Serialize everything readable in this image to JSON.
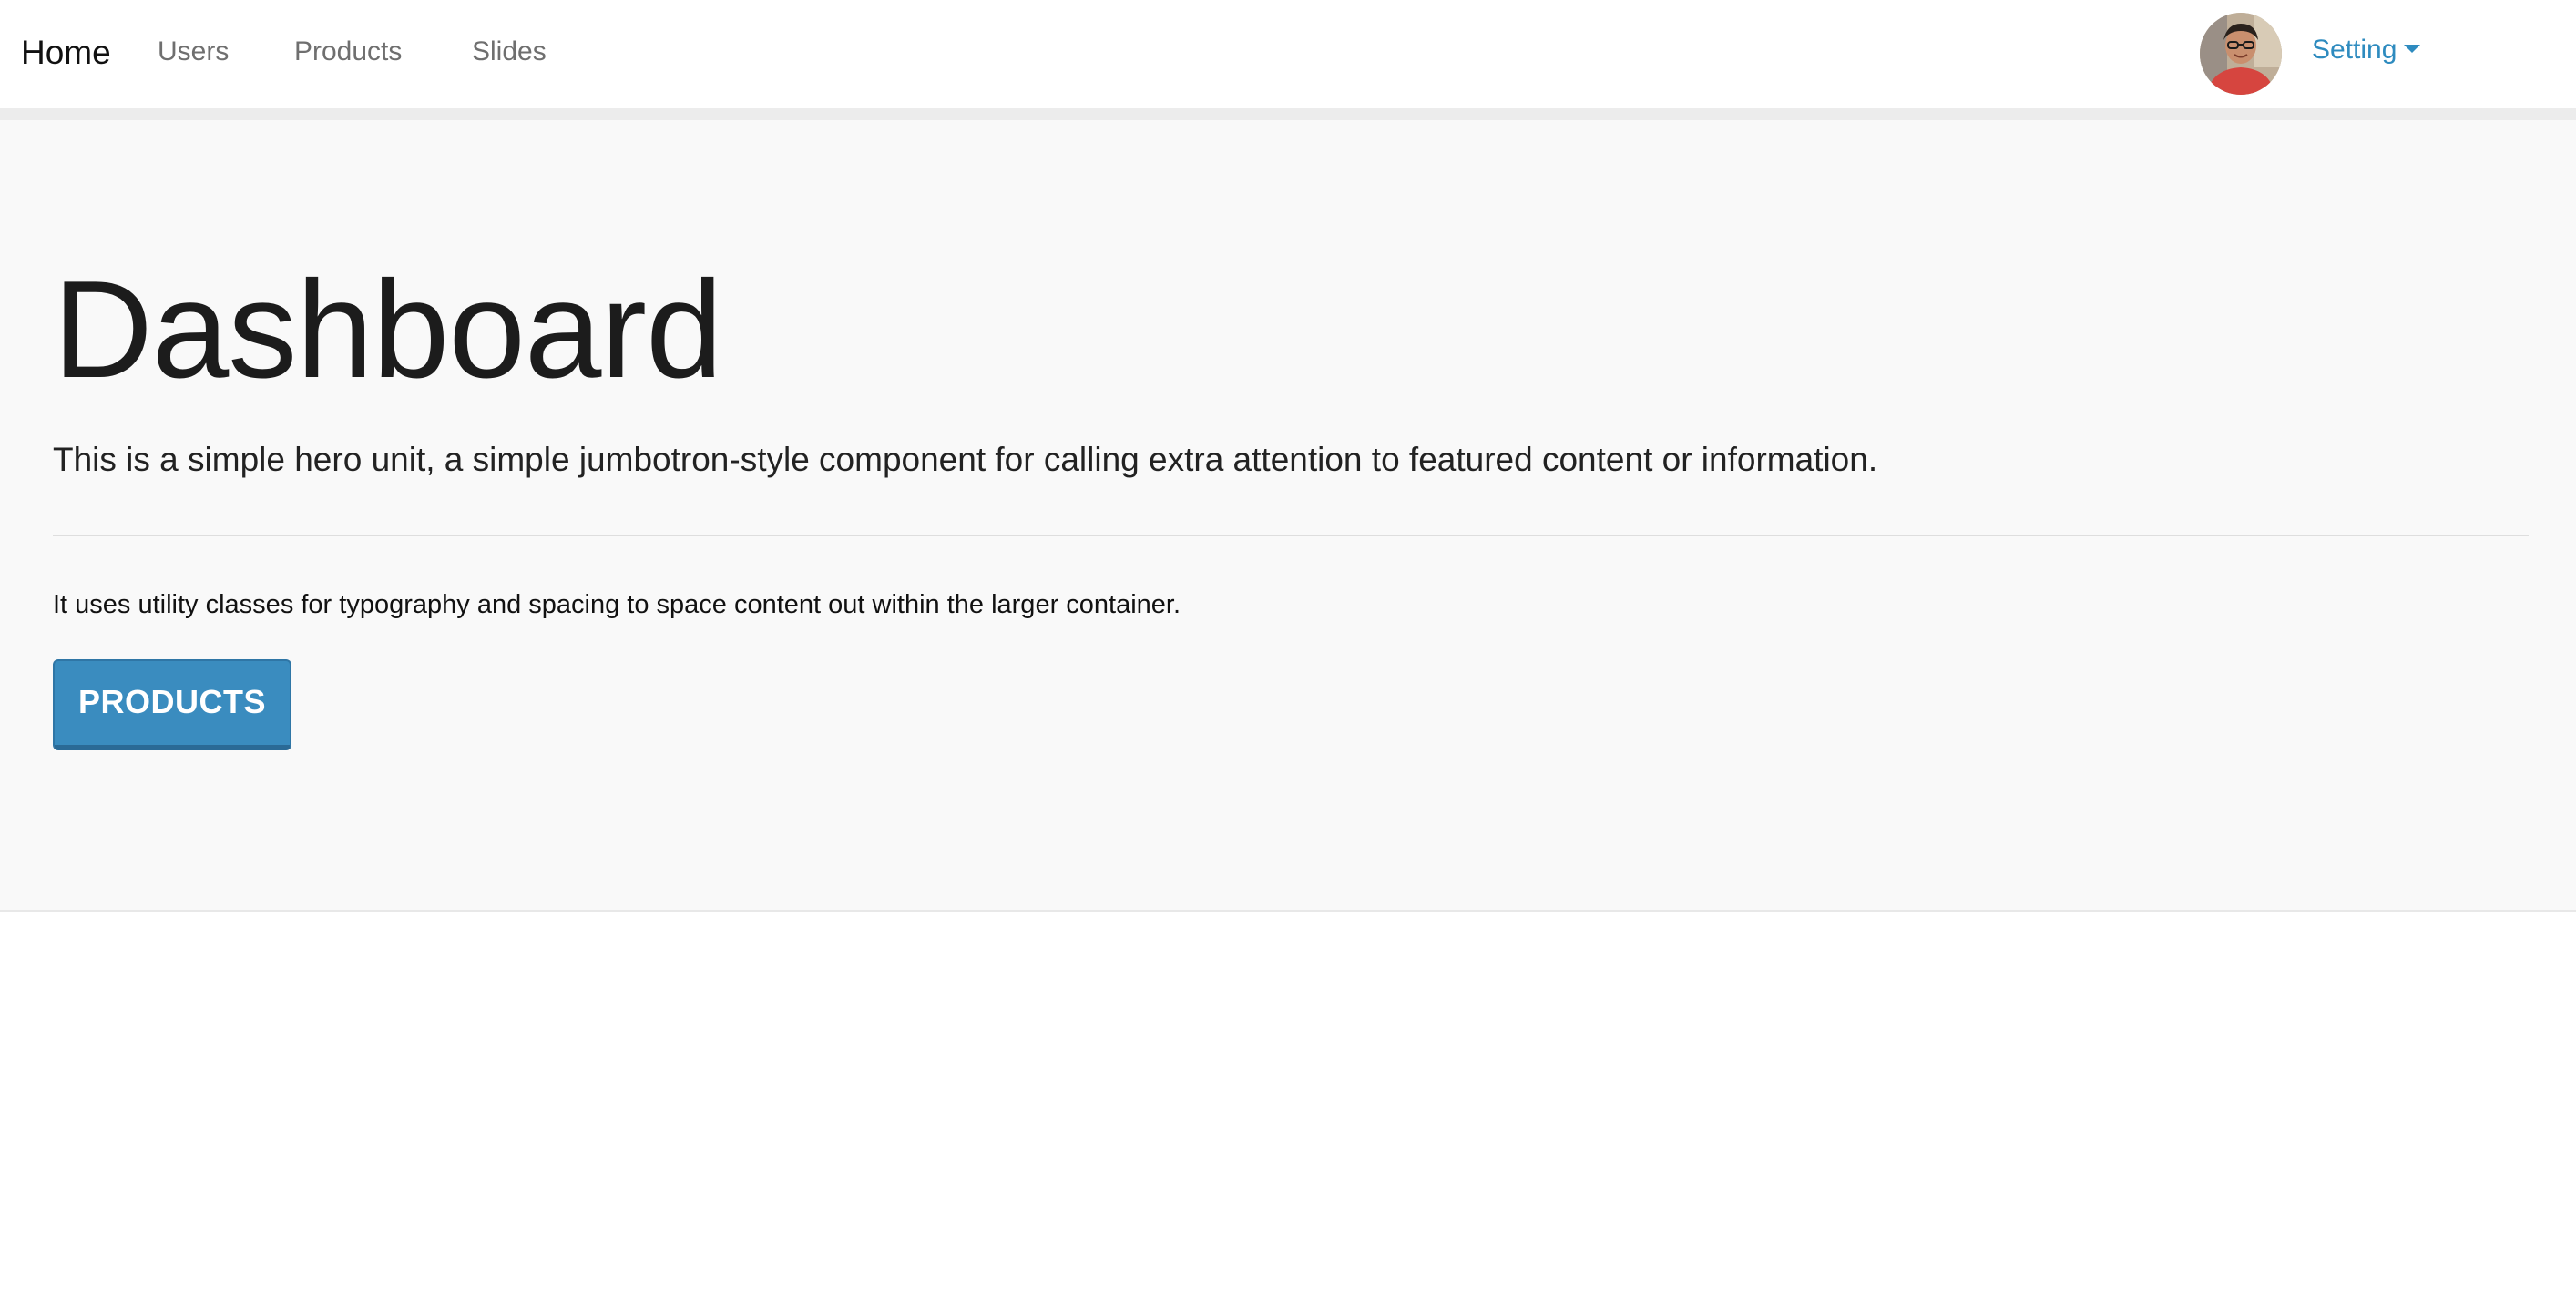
{
  "navbar": {
    "brand": "Home",
    "links": [
      "Users",
      "Products",
      "Slides"
    ],
    "avatar_icon": "user-avatar-icon",
    "setting_label": "Setting",
    "setting_icon": "caret-down-icon",
    "accent_color": "#2e8bbf"
  },
  "hero": {
    "title": "Dashboard",
    "lead": "This is a simple hero unit, a simple jumbotron-style component for calling extra attention to featured content or information.",
    "text": "It uses utility classes for typography and spacing to space content out within the larger container.",
    "button_label": "PRODUCTS",
    "button_color": "#3a8cbf",
    "background_color": "#f9f9f9"
  }
}
